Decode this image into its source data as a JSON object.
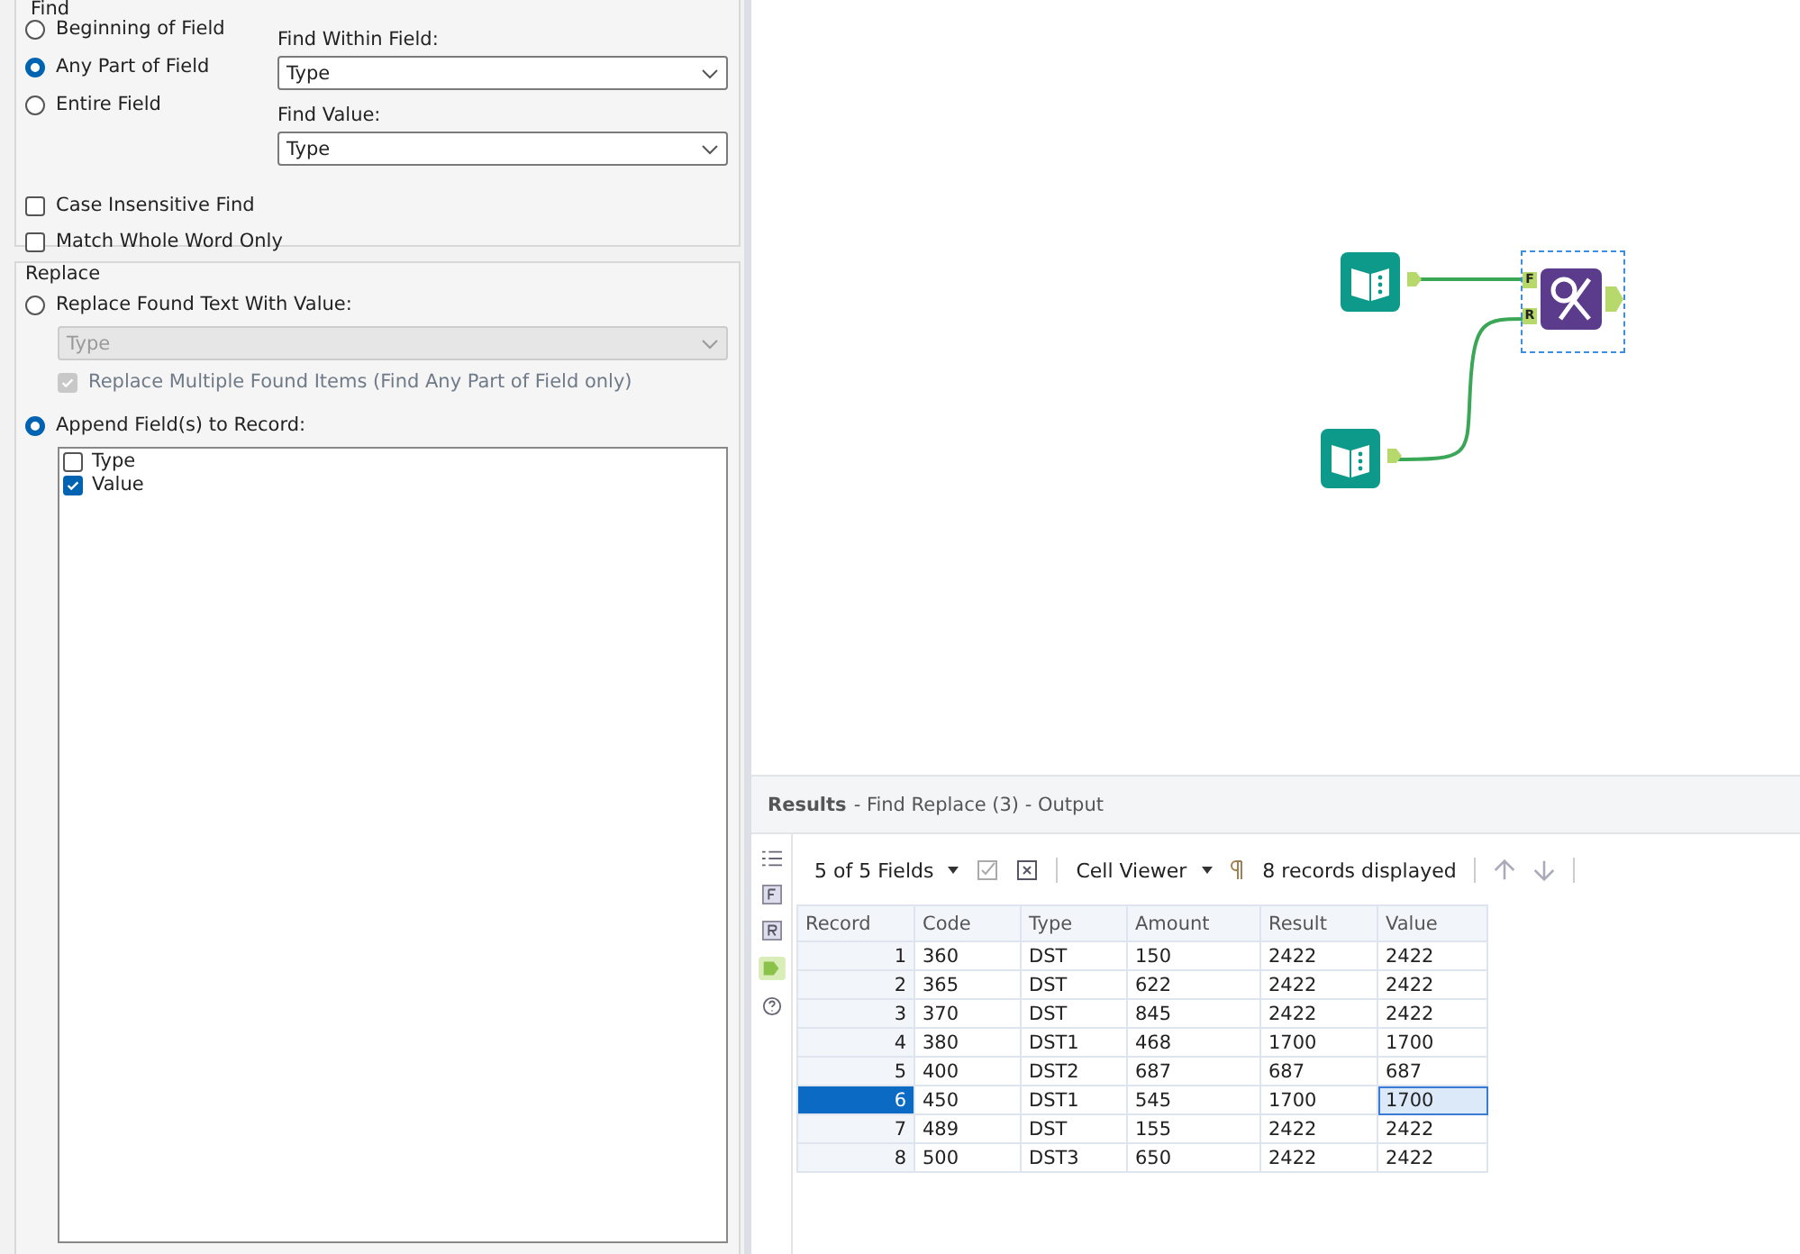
{
  "find": {
    "title": "Find",
    "options": [
      {
        "label": "Beginning of Field",
        "selected": false
      },
      {
        "label": "Any Part of Field",
        "selected": true
      },
      {
        "label": "Entire Field",
        "selected": false
      }
    ],
    "within_label": "Find Within Field:",
    "within_value": "Type",
    "value_label": "Find Value:",
    "value_value": "Type",
    "checks": [
      {
        "label": "Case Insensitive Find",
        "checked": false
      },
      {
        "label": "Match Whole Word Only",
        "checked": false
      }
    ]
  },
  "replace": {
    "title": "Replace",
    "replace_option": {
      "label": "Replace Found Text With Value:",
      "selected": false
    },
    "dropdown": {
      "value": "Type",
      "disabled": true
    },
    "multiple": {
      "label": "Replace Multiple Found Items (Find Any Part of Field only)",
      "checked": true,
      "disabled": true
    },
    "append_option": {
      "label": "Append Field(s) to Record:",
      "selected": true
    },
    "fields": [
      {
        "label": "Type",
        "checked": false
      },
      {
        "label": "Value",
        "checked": true
      }
    ]
  },
  "canvas": {
    "anchor_find": "F",
    "anchor_replace": "R",
    "tool_selected": true
  },
  "results": {
    "title": "Results",
    "subtitle": "- Find Replace (3) - Output",
    "fields_menu": "5 of 5 Fields",
    "viewer_menu": "Cell Viewer",
    "records": "8 records displayed",
    "columns": [
      "Record",
      "Code",
      "Type",
      "Amount",
      "Result",
      "Value"
    ],
    "rows": [
      {
        "cells": [
          "1",
          "360",
          "DST",
          "150",
          "2422",
          "2422"
        ],
        "selected": false
      },
      {
        "cells": [
          "2",
          "365",
          "DST",
          "622",
          "2422",
          "2422"
        ],
        "selected": false
      },
      {
        "cells": [
          "3",
          "370",
          "DST",
          "845",
          "2422",
          "2422"
        ],
        "selected": false
      },
      {
        "cells": [
          "4",
          "380",
          "DST1",
          "468",
          "1700",
          "1700"
        ],
        "selected": false
      },
      {
        "cells": [
          "5",
          "400",
          "DST2",
          "687",
          "687",
          "687"
        ],
        "selected": false
      },
      {
        "cells": [
          "6",
          "450",
          "DST1",
          "545",
          "1700",
          "1700"
        ],
        "selected": true
      },
      {
        "cells": [
          "7",
          "489",
          "DST",
          "155",
          "2422",
          "2422"
        ],
        "selected": false
      },
      {
        "cells": [
          "8",
          "500",
          "DST3",
          "650",
          "2422",
          "2422"
        ],
        "selected": false
      }
    ]
  }
}
